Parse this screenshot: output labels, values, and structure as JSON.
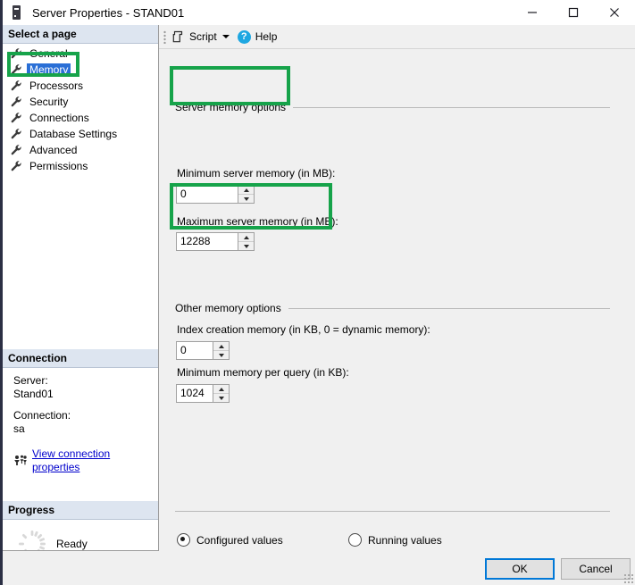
{
  "window": {
    "title": "Server Properties - STAND01",
    "icon": "server-tower-icon",
    "controls": {
      "minimize": "minimize-icon",
      "maximize": "maximize-icon",
      "close": "close-icon"
    }
  },
  "sidebar": {
    "select_page_header": "Select a page",
    "pages": [
      {
        "label": "General",
        "selected": false
      },
      {
        "label": "Memory",
        "selected": true
      },
      {
        "label": "Processors",
        "selected": false
      },
      {
        "label": "Security",
        "selected": false
      },
      {
        "label": "Connections",
        "selected": false
      },
      {
        "label": "Database Settings",
        "selected": false
      },
      {
        "label": "Advanced",
        "selected": false
      },
      {
        "label": "Permissions",
        "selected": false
      }
    ],
    "connection": {
      "header": "Connection",
      "server_label": "Server:",
      "server_value": "Stand01",
      "connection_label": "Connection:",
      "connection_value": "sa",
      "link": "View connection properties"
    },
    "progress": {
      "header": "Progress",
      "status": "Ready"
    }
  },
  "toolbar": {
    "script_label": "Script",
    "help_label": "Help",
    "script_icon": "script-icon",
    "dropdown_icon": "chevron-down-icon",
    "help_icon": "help-question-icon"
  },
  "main": {
    "server_memory_group": "Server memory options",
    "min_server_memory_label": "Minimum server memory (in MB):",
    "min_server_memory_value": "0",
    "max_server_memory_label": "Maximum server memory (in MB):",
    "max_server_memory_value": "12288",
    "other_memory_group": "Other memory options",
    "index_creation_label": "Index creation memory (in KB, 0 = dynamic memory):",
    "index_creation_value": "0",
    "min_memory_per_query_label": "Minimum memory per query (in KB):",
    "min_memory_per_query_value": "1024",
    "radio_configured": "Configured values",
    "radio_running": "Running values",
    "radio_selected": "Configured values"
  },
  "footer": {
    "ok_label": "OK",
    "cancel_label": "Cancel"
  },
  "colors": {
    "annotation_green": "#16a34a",
    "selection_blue": "#2a6fd6",
    "focus_blue": "#0078d7",
    "help_icon_blue": "#1ea7e1",
    "link_blue": "#0000cc"
  }
}
